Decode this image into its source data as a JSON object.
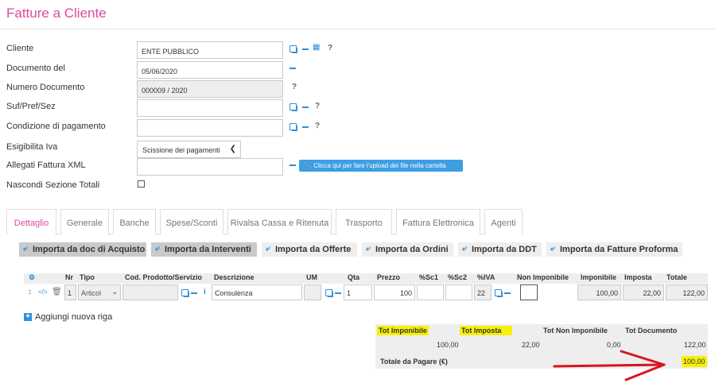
{
  "title": "Fatture a Cliente",
  "form": {
    "cliente_label": "Cliente",
    "cliente_value": "ENTE PUBBLICO",
    "documento_del_label": "Documento del",
    "documento_del_value": "05/06/2020",
    "numero_documento_label": "Numero Documento",
    "numero_documento_value": "000009 / 2020",
    "suf_label": "Suf/Pref/Sez",
    "condizione_label": "Condizione di pagamento",
    "esigibilita_label": "Esigibilita Iva",
    "esigibilita_value": "Scissione dei pagamenti",
    "allegati_label": "Allegati Fattura XML",
    "upload_label": "Clicca qui per fare l'upload dei file nella cartella",
    "nascondi_label": "Nascondi Sezione Totali",
    "help": "?"
  },
  "tabs": [
    "Dettaglio",
    "Generale",
    "Banche",
    "Spese/Sconti",
    "Rivalsa Cassa e Ritenuta",
    "Trasporto",
    "Fattura Elettronica",
    "Agenti"
  ],
  "import_buttons": [
    "Importa da doc di Acquisto",
    "Importa da Interventi",
    "Importa da Offerte",
    "Importa da Ordini",
    "Importa da DDT",
    "Importa da Fatture Proforma"
  ],
  "grid": {
    "headers": [
      "Nr",
      "Tipo",
      "Cod. Prodotto/Servizio",
      "Descrizione",
      "UM",
      "Qta",
      "Prezzo",
      "%Sc1",
      "%Sc2",
      "%IVA",
      "Non Imponibile",
      "Imponibile",
      "Imposta",
      "Totale"
    ],
    "row": {
      "nr": "1",
      "tipo": "Articol",
      "descrizione": "Consulenza",
      "qta": "1",
      "prezzo": "100",
      "iva": "22",
      "imponibile": "100,00",
      "imposta": "22,00",
      "totale": "122,00"
    }
  },
  "add_row_label": "Aggiungi nuova riga",
  "totals": {
    "tot_imponibile_label": "Tot Imponibile",
    "tot_imposta_label": "Tot Imposta",
    "tot_non_imponibile_label": "Tot Non Imponibile",
    "tot_documento_label": "Tot Documento",
    "tot_imponibile_value": "100,00",
    "tot_imposta_value": "22,00",
    "tot_non_imponibile_value": "0,00",
    "tot_documento_value": "122,00",
    "totale_pagare_label": "Totale da Pagare (€)",
    "totale_pagare_value": "100,00"
  },
  "colors": {
    "accent": "#e0479e",
    "primary": "#2e8fd6",
    "highlight": "#f6f00a",
    "arrow": "#d9141c"
  }
}
